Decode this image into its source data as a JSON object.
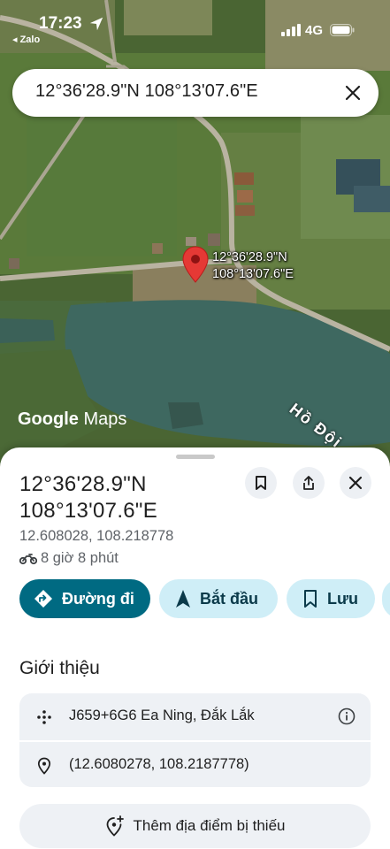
{
  "status_bar": {
    "time": "17:23",
    "back_app": "◂ Zalo",
    "network": "4G"
  },
  "search": {
    "query": "12°36'28.9\"N 108°13'07.6\"E"
  },
  "map": {
    "pin_label_line1": "12°36'28.9\"N",
    "pin_label_line2": "108°13'07.6\"E",
    "lake_label": "Hồ Đội",
    "logo_word1": "Google",
    "logo_word2": "Maps",
    "pin_color": "#e53935"
  },
  "sheet": {
    "title_line1": "12°36'28.9\"N",
    "title_line2": "108°13'07.6\"E",
    "decimal_coords": "12.608028, 108.218778",
    "eta": "8 giờ 8 phút",
    "actions": {
      "directions": "Đường đi",
      "start": "Bắt đầu",
      "save": "Lưu"
    },
    "about_heading": "Giới thiệu",
    "plus_code": "J659+6G6 Ea Ning, Đắk Lắk",
    "precise_coords": "(12.6080278, 108.2187778)",
    "add_place": "Thêm địa điểm bị thiếu"
  },
  "colors": {
    "primary": "#006a82",
    "chip_light": "#cfeef7",
    "card_bg": "#eef1f5"
  }
}
